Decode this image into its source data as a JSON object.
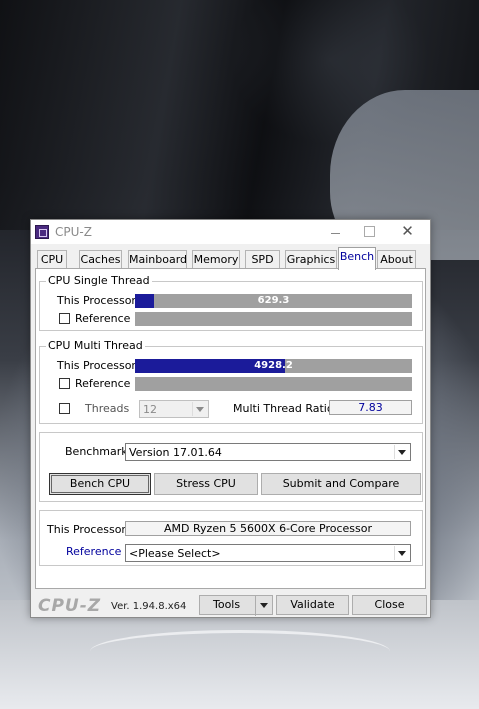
{
  "window": {
    "title": "CPU-Z"
  },
  "tabs": [
    {
      "label": "CPU"
    },
    {
      "label": "Caches"
    },
    {
      "label": "Mainboard"
    },
    {
      "label": "Memory"
    },
    {
      "label": "SPD"
    },
    {
      "label": "Graphics"
    },
    {
      "label": "Bench"
    },
    {
      "label": "About"
    }
  ],
  "active_tab": "Bench",
  "single_thread": {
    "legend": "CPU Single Thread",
    "this_processor_label": "This Processor",
    "this_processor_value": "629.3",
    "this_processor_fill": 0.07,
    "reference_label": "Reference",
    "reference_checked": false
  },
  "multi_thread": {
    "legend": "CPU Multi Thread",
    "this_processor_label": "This Processor",
    "this_processor_value": "4928.2",
    "this_processor_fill": 0.54,
    "reference_label": "Reference",
    "reference_checked": false,
    "threads_label": "Threads",
    "threads_value": "12",
    "ratio_label": "Multi Thread Ratio",
    "ratio_value": "7.83"
  },
  "benchmark": {
    "label": "Benchmark",
    "version": "Version 17.01.64",
    "bench_cpu": "Bench CPU",
    "stress_cpu": "Stress CPU",
    "submit": "Submit and Compare"
  },
  "processor": {
    "this_label": "This Processor",
    "this_value": "AMD Ryzen 5 5600X 6-Core Processor",
    "reference_label": "Reference",
    "reference_value": "<Please Select>"
  },
  "footer": {
    "brand": "CPU-Z",
    "version": "Ver. 1.94.8.x64",
    "tools": "Tools",
    "validate": "Validate",
    "close": "Close"
  },
  "colors": {
    "bar_fill": "#1b1b9a",
    "bar_bg": "#a0a0a0",
    "link": "#00009c"
  }
}
